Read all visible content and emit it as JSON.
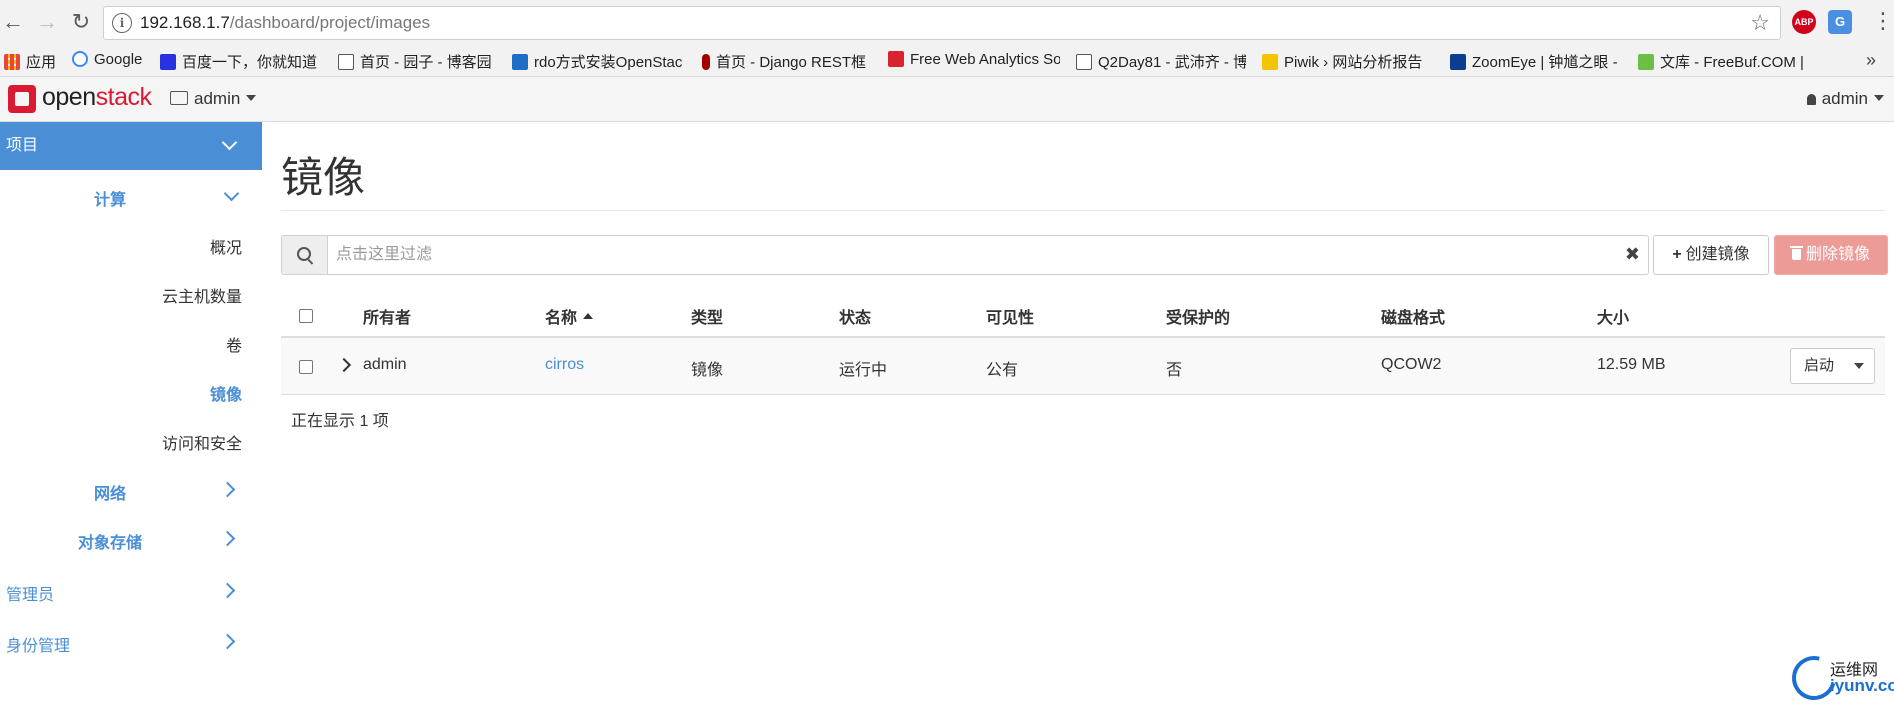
{
  "browser": {
    "url_host": "192.168.1.7",
    "url_path": "/dashboard/project/images",
    "extensions": [
      "ABP",
      "G"
    ],
    "bookmarks": [
      {
        "label": "应用",
        "color": "#e8453c"
      },
      {
        "label": "Google",
        "color": "#4285f4"
      },
      {
        "label": "百度一下，你就知道",
        "color": "#2932e1"
      },
      {
        "label": "首页 - 园子 - 博客园",
        "color": "#555555"
      },
      {
        "label": "rdo方式安装OpenStac",
        "color": "#1e6ec8"
      },
      {
        "label": "首页 - Django REST框",
        "color": "#a30000"
      },
      {
        "label": "Free Web Analytics So",
        "color": "#d9232d"
      },
      {
        "label": "Q2Day81 - 武沛齐 - 博",
        "color": "#555555"
      },
      {
        "label": "Piwik › 网站分析报告",
        "color": "#f5c400"
      },
      {
        "label": "ZoomEye | 钟馗之眼 -",
        "color": "#0b3d91"
      },
      {
        "label": "文库 - FreeBuf.COM |",
        "color": "#6cbe45"
      }
    ],
    "more_label": "»"
  },
  "header": {
    "logo_text_a": "open",
    "logo_text_b": "stack",
    "project_label": "admin",
    "user_label": "admin"
  },
  "sidebar": {
    "project": "项目",
    "compute": "计算",
    "items": [
      "概况",
      "云主机数量",
      "卷",
      "镜像",
      "访问和安全"
    ],
    "active_item": "镜像",
    "network": "网络",
    "object_store": "对象存储",
    "admin": "管理员",
    "identity": "身份管理"
  },
  "main": {
    "title": "镜像",
    "filter_placeholder": "点击这里过滤",
    "filter_clear": "✖",
    "create_label": "创建镜像",
    "delete_label": "删除镜像",
    "columns": [
      "所有者",
      "名称",
      "类型",
      "状态",
      "可见性",
      "受保护的",
      "磁盘格式",
      "大小"
    ],
    "rows": [
      {
        "owner": "admin",
        "name": "cirros",
        "type": "镜像",
        "status": "运行中",
        "visibility": "公有",
        "protected": "否",
        "format": "QCOW2",
        "size": "12.59 MB",
        "action": "启动"
      }
    ],
    "count_text": "正在显示 1 项"
  },
  "watermark": {
    "line1": "运维网",
    "line2": "iyunv.com"
  }
}
